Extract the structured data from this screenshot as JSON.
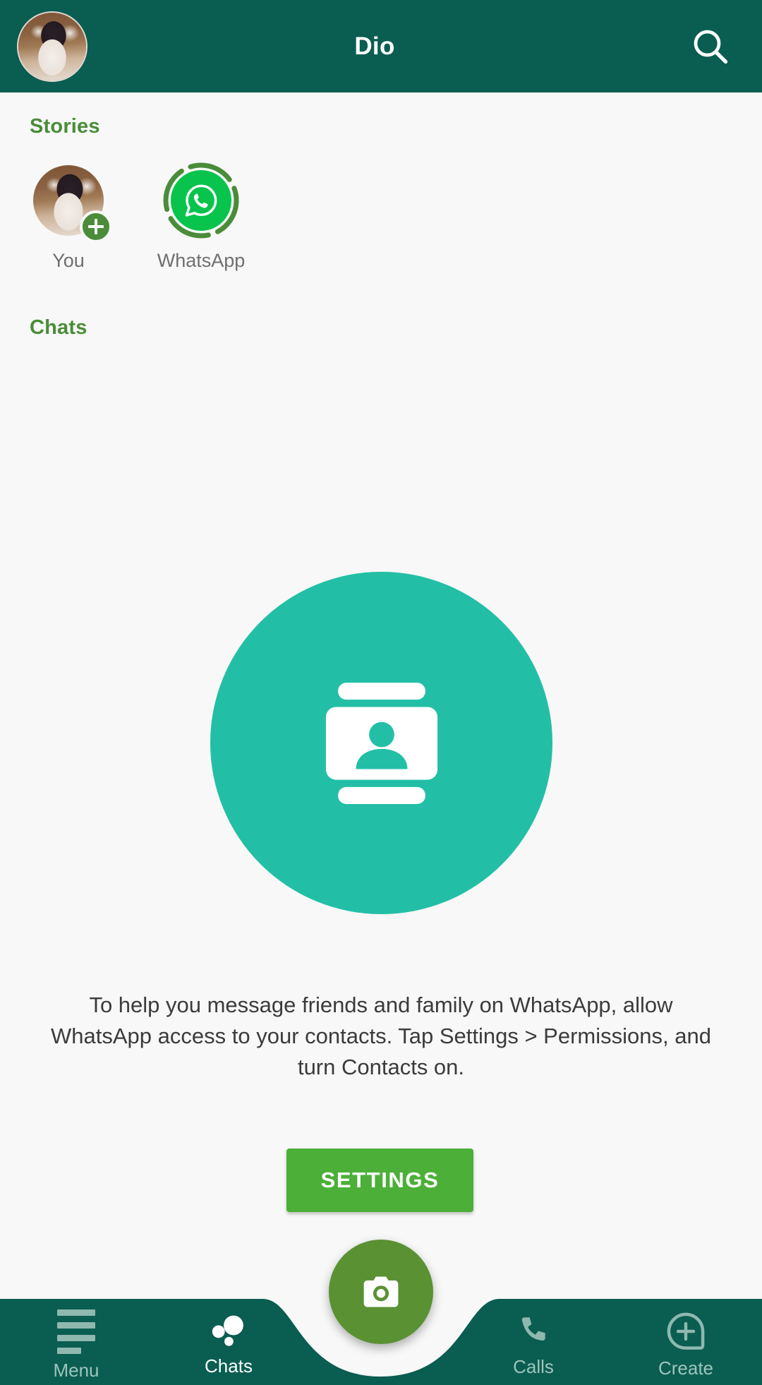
{
  "theme": {
    "appbar_teal": "#0a5d51",
    "page_bg": "#f7f8f7",
    "accent_green": "#4a8c39",
    "whatsapp_green": "#08c44c",
    "empty_teal": "#22bfa6",
    "settings_green": "#4caf38",
    "fab_green": "#5a9133",
    "nav_inactive": "#9ec4bc",
    "nav_active": "#ffffff",
    "label_gray": "#6f6f6f"
  },
  "appbar": {
    "title": "Dio",
    "avatar_icon": "profile-avatar",
    "search_icon": "search-icon"
  },
  "stories": {
    "section_title": "Stories",
    "items": [
      {
        "label": "You",
        "icon": "profile-avatar",
        "badge_icon": "plus-icon",
        "has_add_badge": true,
        "unseen": false
      },
      {
        "label": "WhatsApp",
        "icon": "whatsapp-logo-icon",
        "has_add_badge": false,
        "unseen": true
      }
    ]
  },
  "chats": {
    "section_title": "Chats",
    "empty_state": {
      "illustration_icon": "contacts-card-icon",
      "message": "To help you message friends and family on WhatsApp, allow WhatsApp access to your contacts. Tap Settings > Permissions, and turn Contacts on.",
      "button_label": "SETTINGS"
    }
  },
  "fab": {
    "icon": "camera-icon",
    "label": ""
  },
  "bottom_nav": {
    "items": [
      {
        "label": "Menu",
        "icon": "menu-lines-icon",
        "active": false
      },
      {
        "label": "Chats",
        "icon": "chat-dots-icon",
        "active": true
      },
      {
        "label": "Calls",
        "icon": "phone-icon",
        "active": false
      },
      {
        "label": "Create",
        "icon": "plus-circle-icon",
        "active": false
      }
    ]
  }
}
